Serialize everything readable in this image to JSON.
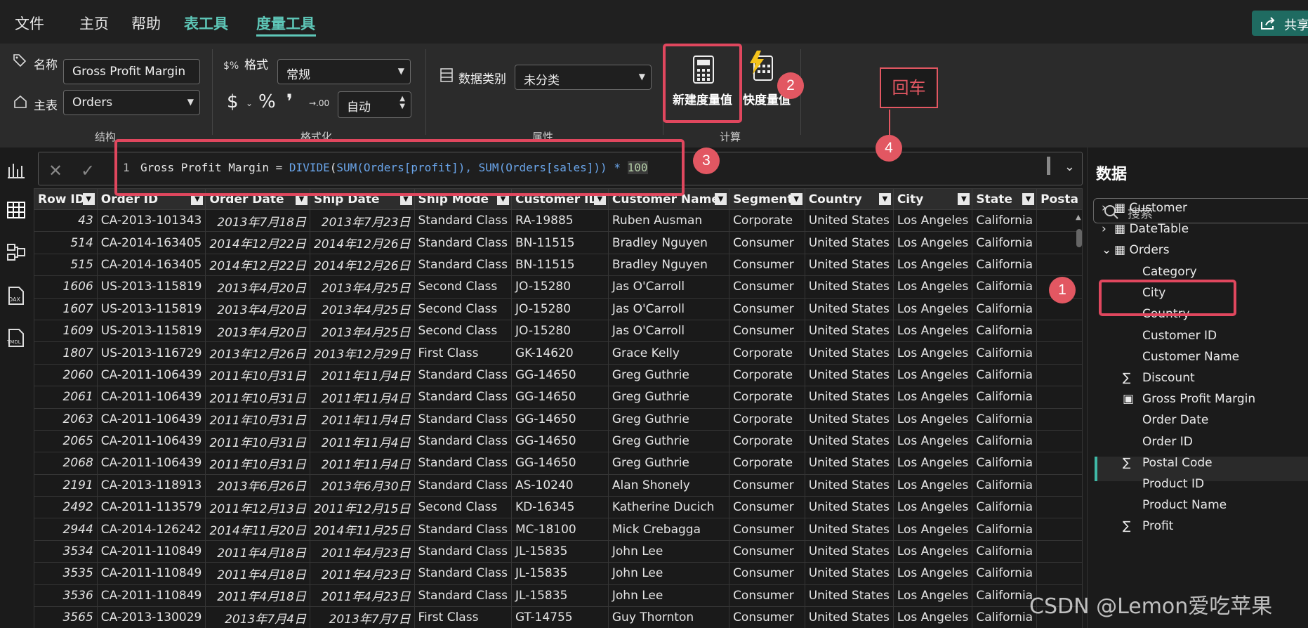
{
  "menu": {
    "file": "文件",
    "home": "主页",
    "help": "帮助",
    "table_tools": "表工具",
    "measure_tools": "度量工具",
    "share": "共享"
  },
  "ribbon": {
    "name_label": "名称",
    "name_value": "Gross Profit Margin",
    "table_label": "主表",
    "table_value": "Orders",
    "group_structure": "结构",
    "format_label": "格式",
    "format_value": "常规",
    "currency_symbol": "$",
    "percent_symbol": "%",
    "comma_symbol": "❜",
    "decimal_symbol": "→.00",
    "decimal_value": "自动",
    "group_formatting": "格式化",
    "category_label": "数据类别",
    "category_value": "未分类",
    "group_properties": "属性",
    "new_measure": "新建度量值",
    "quick_measure": "快度量值",
    "group_calculations": "计算"
  },
  "formula": {
    "line_number": "1",
    "t1": "Gross Profit Margin = ",
    "t2": "DIVIDE",
    "t3": "(",
    "t4": "SUM",
    "t5": "(Orders[profit]), ",
    "t6": "SUM",
    "t7": "(Orders[sales])) * ",
    "t8": "100"
  },
  "columns": [
    "Row ID",
    "Order ID",
    "Order Date",
    "Ship Date",
    "Ship Mode",
    "Customer ID",
    "Customer Name",
    "Segment",
    "Country",
    "City",
    "State",
    "Posta"
  ],
  "rows": [
    [
      "43",
      "CA-2013-101343",
      "2013年7月18日",
      "2013年7月23日",
      "Standard Class",
      "RA-19885",
      "Ruben Ausman",
      "Corporate",
      "United States",
      "Los Angeles",
      "California",
      ""
    ],
    [
      "514",
      "CA-2014-163405",
      "2014年12月22日",
      "2014年12月26日",
      "Standard Class",
      "BN-11515",
      "Bradley Nguyen",
      "Consumer",
      "United States",
      "Los Angeles",
      "California",
      ""
    ],
    [
      "515",
      "CA-2014-163405",
      "2014年12月22日",
      "2014年12月26日",
      "Standard Class",
      "BN-11515",
      "Bradley Nguyen",
      "Consumer",
      "United States",
      "Los Angeles",
      "California",
      ""
    ],
    [
      "1606",
      "US-2013-115819",
      "2013年4月20日",
      "2013年4月25日",
      "Second Class",
      "JO-15280",
      "Jas O'Carroll",
      "Consumer",
      "United States",
      "Los Angeles",
      "California",
      ""
    ],
    [
      "1607",
      "US-2013-115819",
      "2013年4月20日",
      "2013年4月25日",
      "Second Class",
      "JO-15280",
      "Jas O'Carroll",
      "Consumer",
      "United States",
      "Los Angeles",
      "California",
      ""
    ],
    [
      "1609",
      "US-2013-115819",
      "2013年4月20日",
      "2013年4月25日",
      "Second Class",
      "JO-15280",
      "Jas O'Carroll",
      "Consumer",
      "United States",
      "Los Angeles",
      "California",
      ""
    ],
    [
      "1807",
      "US-2013-116729",
      "2013年12月26日",
      "2013年12月29日",
      "First Class",
      "GK-14620",
      "Grace Kelly",
      "Corporate",
      "United States",
      "Los Angeles",
      "California",
      ""
    ],
    [
      "2060",
      "CA-2011-106439",
      "2011年10月31日",
      "2011年11月4日",
      "Standard Class",
      "GG-14650",
      "Greg Guthrie",
      "Corporate",
      "United States",
      "Los Angeles",
      "California",
      ""
    ],
    [
      "2061",
      "CA-2011-106439",
      "2011年10月31日",
      "2011年11月4日",
      "Standard Class",
      "GG-14650",
      "Greg Guthrie",
      "Corporate",
      "United States",
      "Los Angeles",
      "California",
      ""
    ],
    [
      "2063",
      "CA-2011-106439",
      "2011年10月31日",
      "2011年11月4日",
      "Standard Class",
      "GG-14650",
      "Greg Guthrie",
      "Corporate",
      "United States",
      "Los Angeles",
      "California",
      ""
    ],
    [
      "2065",
      "CA-2011-106439",
      "2011年10月31日",
      "2011年11月4日",
      "Standard Class",
      "GG-14650",
      "Greg Guthrie",
      "Corporate",
      "United States",
      "Los Angeles",
      "California",
      ""
    ],
    [
      "2068",
      "CA-2011-106439",
      "2011年10月31日",
      "2011年11月4日",
      "Standard Class",
      "GG-14650",
      "Greg Guthrie",
      "Corporate",
      "United States",
      "Los Angeles",
      "California",
      ""
    ],
    [
      "2191",
      "CA-2013-118913",
      "2013年6月26日",
      "2013年6月30日",
      "Standard Class",
      "AS-10240",
      "Alan Shonely",
      "Consumer",
      "United States",
      "Los Angeles",
      "California",
      ""
    ],
    [
      "2492",
      "CA-2011-113579",
      "2011年12月13日",
      "2011年12月15日",
      "Second Class",
      "KD-16345",
      "Katherine Ducich",
      "Consumer",
      "United States",
      "Los Angeles",
      "California",
      ""
    ],
    [
      "2944",
      "CA-2014-126242",
      "2014年11月20日",
      "2014年11月25日",
      "Standard Class",
      "MC-18100",
      "Mick Crebagga",
      "Consumer",
      "United States",
      "Los Angeles",
      "California",
      ""
    ],
    [
      "3534",
      "CA-2011-110849",
      "2011年4月18日",
      "2011年4月23日",
      "Standard Class",
      "JL-15835",
      "John Lee",
      "Consumer",
      "United States",
      "Los Angeles",
      "California",
      ""
    ],
    [
      "3535",
      "CA-2011-110849",
      "2011年4月18日",
      "2011年4月23日",
      "Standard Class",
      "JL-15835",
      "John Lee",
      "Consumer",
      "United States",
      "Los Angeles",
      "California",
      ""
    ],
    [
      "3536",
      "CA-2011-110849",
      "2011年4月18日",
      "2011年4月23日",
      "Standard Class",
      "JL-15835",
      "John Lee",
      "Consumer",
      "United States",
      "Los Angeles",
      "California",
      ""
    ],
    [
      "3565",
      "CA-2013-130029",
      "2013年7月4日",
      "2013年7月7日",
      "First Class",
      "GT-14755",
      "Guy Thornton",
      "Consumer",
      "United States",
      "Los Angeles",
      "California",
      ""
    ]
  ],
  "pane": {
    "title": "数据",
    "search_placeholder": "搜索",
    "tables": [
      "Customer",
      "DateTable",
      "Orders"
    ],
    "fields": [
      "Category",
      "City",
      "Country",
      "Customer ID",
      "Customer Name",
      "Discount",
      "Gross Profit Margin",
      "Order Date",
      "Order ID",
      "Postal Code",
      "Product ID",
      "Product Name",
      "Profit"
    ]
  },
  "annotations": {
    "n1": "1",
    "n2": "2",
    "n3": "3",
    "n4": "4",
    "enter": "回车"
  },
  "watermark": "CSDN @Lemon爱吃苹果"
}
